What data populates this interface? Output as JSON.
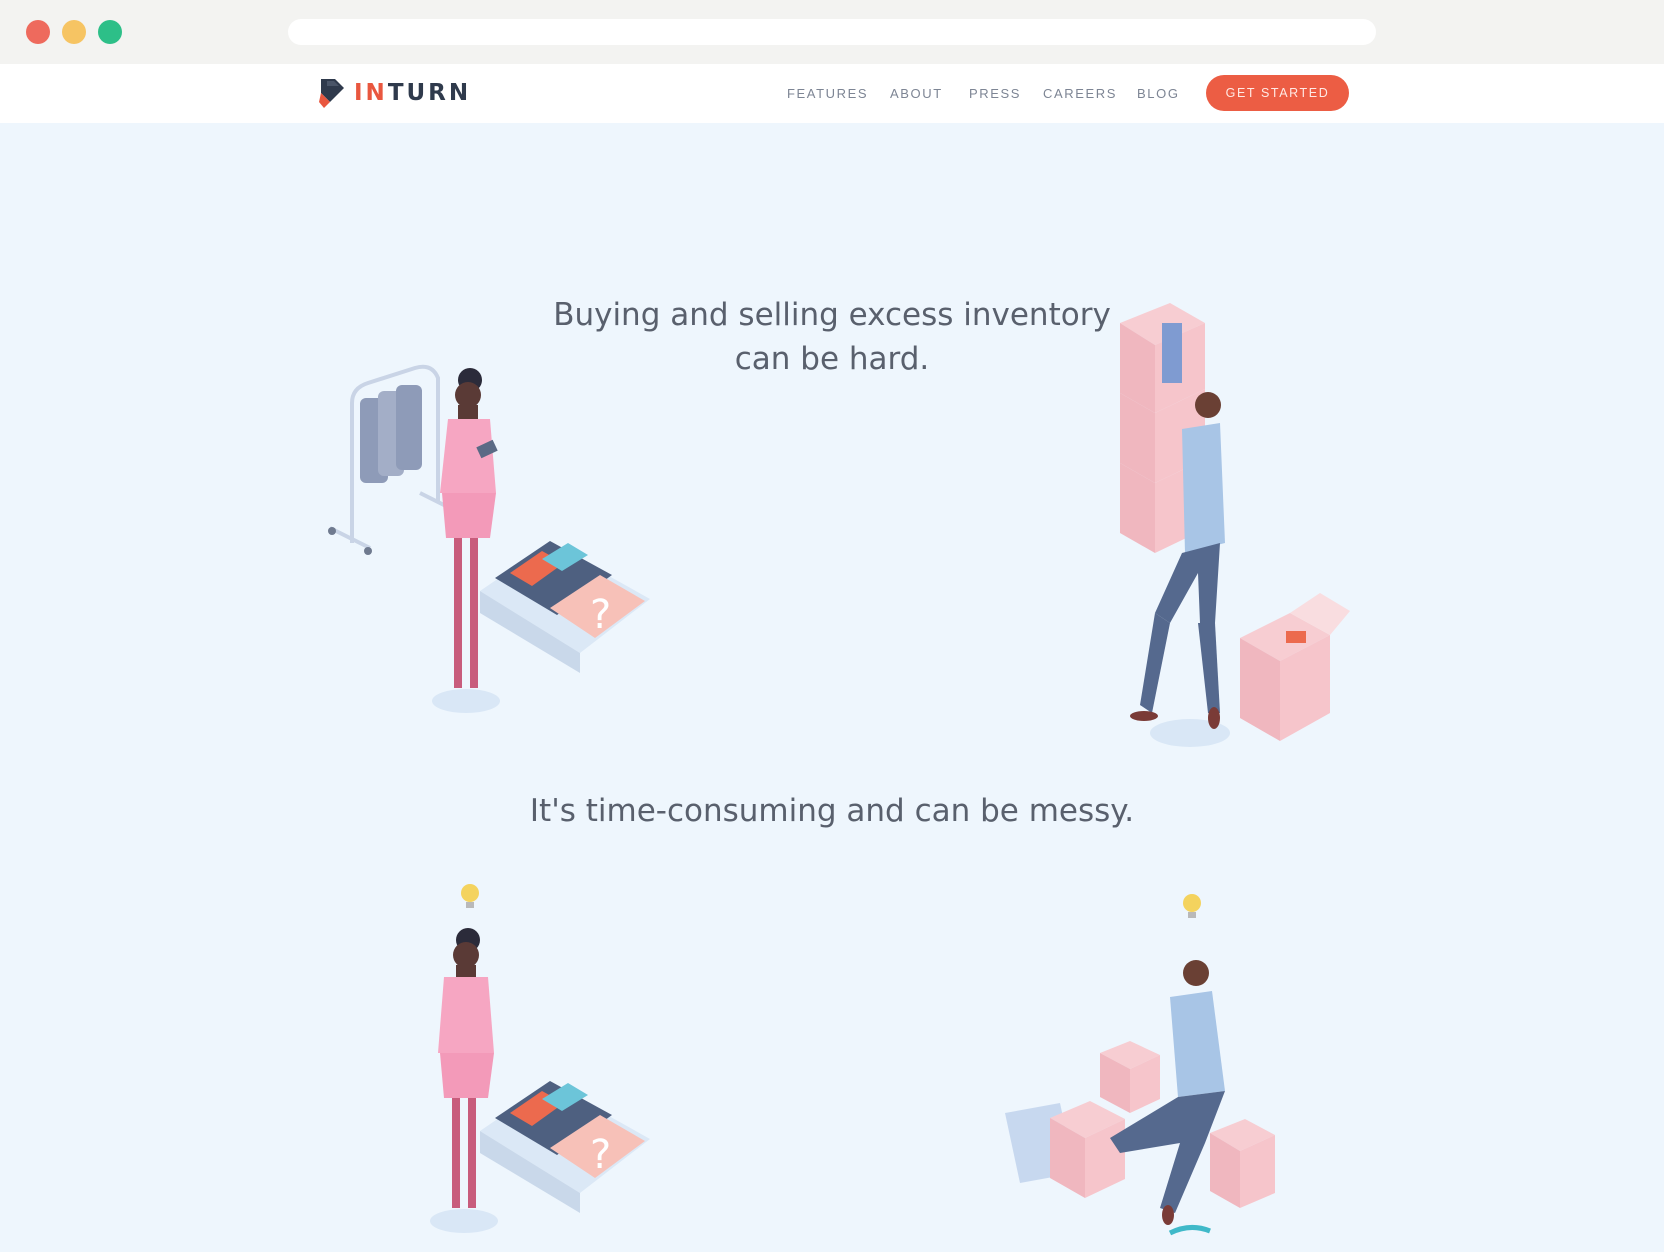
{
  "browser": {
    "window_controls": [
      "close",
      "minimize",
      "maximize"
    ]
  },
  "header": {
    "logo_text_accent": "IN",
    "logo_text_rest": "TURN",
    "nav": [
      {
        "label": "FEATURES"
      },
      {
        "label": "ABOUT"
      },
      {
        "label": "PRESS"
      },
      {
        "label": "CAREERS"
      },
      {
        "label": "BLOG"
      }
    ],
    "cta_label": "GET STARTED"
  },
  "sections": [
    {
      "headline_line1": "Buying and selling excess inventory",
      "headline_line2": "can be hard."
    },
    {
      "headline_line1": "It's time-consuming and can be messy."
    }
  ],
  "colors": {
    "accent": "#ec5d44",
    "background": "#eef6fd",
    "text": "#59606d",
    "nav_text": "#7d8594"
  }
}
